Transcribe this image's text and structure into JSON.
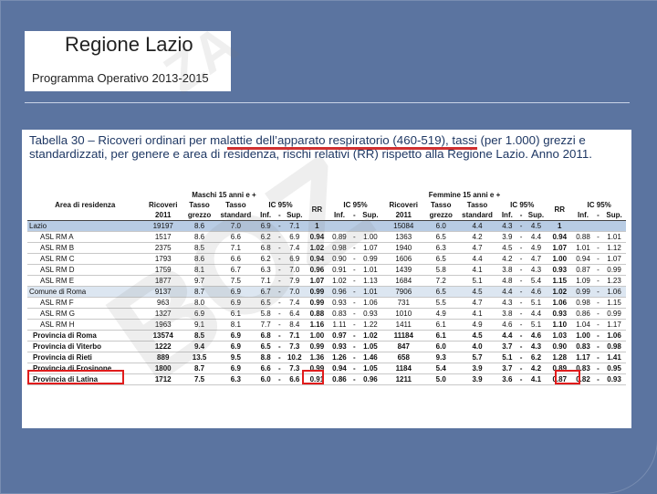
{
  "header": {
    "title": "Regione Lazio",
    "subtitle": "Programma Operativo 2013-2015"
  },
  "caption": "Tabella 30 – Ricoveri ordinari per malattie dell’apparato respiratorio (460-519), tassi (per 1.000) grezzi e standardizzati, per genere e area di residenza, rischi relativi (RR) rispetto alla Regione Lazio. Anno 2011.",
  "watermark": {
    "main": "BOZ",
    "top": "ZA"
  },
  "table": {
    "group_males": "Maschi  15 anni e +",
    "group_females": "Femmine  15 anni e +",
    "ic_label": "IC 95%",
    "h1": [
      "Area di residenza",
      "Ricoveri",
      "Tasso",
      "Tasso",
      "IC 95%",
      "RR",
      "IC 95%",
      "Ricoveri",
      "Tasso",
      "Tasso",
      "IC 95%",
      "RR",
      "IC 95%"
    ],
    "h2": [
      "",
      "2011",
      "grezzo",
      "standard",
      "Inf.",
      "-",
      "Sup.",
      "",
      "Inf.",
      "-",
      "Sup.",
      "2011",
      "grezzo",
      "standard",
      "Inf.",
      "-",
      "Sup.",
      "",
      "Inf.",
      "-",
      "Sup."
    ],
    "rows": [
      [
        "Lazio",
        "19197",
        "8.6",
        "7.0",
        "6.9",
        "-",
        "7.1",
        "1",
        "",
        "",
        "",
        "15084",
        "6.0",
        "4.4",
        "4.3",
        "-",
        "4.5",
        "1",
        "",
        "",
        ""
      ],
      [
        "ASL RM A",
        "1517",
        "8.6",
        "6.6",
        "6.2",
        "-",
        "6.9",
        "0.94",
        "0.89",
        "-",
        "1.00",
        "1363",
        "6.5",
        "4.2",
        "3.9",
        "-",
        "4.4",
        "0.94",
        "0.88",
        "-",
        "1.01"
      ],
      [
        "ASL RM B",
        "2375",
        "8.5",
        "7.1",
        "6.8",
        "-",
        "7.4",
        "1.02",
        "0.98",
        "-",
        "1.07",
        "1940",
        "6.3",
        "4.7",
        "4.5",
        "-",
        "4.9",
        "1.07",
        "1.01",
        "-",
        "1.12"
      ],
      [
        "ASL RM C",
        "1793",
        "8.6",
        "6.6",
        "6.2",
        "-",
        "6.9",
        "0.94",
        "0.90",
        "-",
        "0.99",
        "1606",
        "6.5",
        "4.4",
        "4.2",
        "-",
        "4.7",
        "1.00",
        "0.94",
        "-",
        "1.07"
      ],
      [
        "ASL RM D",
        "1759",
        "8.1",
        "6.7",
        "6.3",
        "-",
        "7.0",
        "0.96",
        "0.91",
        "-",
        "1.01",
        "1439",
        "5.8",
        "4.1",
        "3.8",
        "-",
        "4.3",
        "0.93",
        "0.87",
        "-",
        "0.99"
      ],
      [
        "ASL RM E",
        "1877",
        "9.7",
        "7.5",
        "7.1",
        "-",
        "7.9",
        "1.07",
        "1.02",
        "-",
        "1.13",
        "1684",
        "7.2",
        "5.1",
        "4.8",
        "-",
        "5.4",
        "1.15",
        "1.09",
        "-",
        "1.23"
      ],
      [
        "Comune di Roma",
        "9137",
        "8.7",
        "6.9",
        "6.7",
        "-",
        "7.0",
        "0.99",
        "0.96",
        "-",
        "1.01",
        "7906",
        "6.5",
        "4.5",
        "4.4",
        "-",
        "4.6",
        "1.02",
        "0.99",
        "-",
        "1.06"
      ],
      [
        "ASL RM F",
        "963",
        "8.0",
        "6.9",
        "6.5",
        "-",
        "7.4",
        "0.99",
        "0.93",
        "-",
        "1.06",
        "731",
        "5.5",
        "4.7",
        "4.3",
        "-",
        "5.1",
        "1.06",
        "0.98",
        "-",
        "1.15"
      ],
      [
        "ASL RM G",
        "1327",
        "6.9",
        "6.1",
        "5.8",
        "-",
        "6.4",
        "0.88",
        "0.83",
        "-",
        "0.93",
        "1010",
        "4.9",
        "4.1",
        "3.8",
        "-",
        "4.4",
        "0.93",
        "0.86",
        "-",
        "0.99"
      ],
      [
        "ASL RM H",
        "1963",
        "9.1",
        "8.1",
        "7.7",
        "-",
        "8.4",
        "1.16",
        "1.11",
        "-",
        "1.22",
        "1411",
        "6.1",
        "4.9",
        "4.6",
        "-",
        "5.1",
        "1.10",
        "1.04",
        "-",
        "1.17"
      ],
      [
        "Provincia di Roma",
        "13574",
        "8.5",
        "6.9",
        "6.8",
        "-",
        "7.1",
        "1.00",
        "0.97",
        "-",
        "1.02",
        "11184",
        "6.1",
        "4.5",
        "4.4",
        "-",
        "4.6",
        "1.03",
        "1.00",
        "-",
        "1.06"
      ],
      [
        "Provincia di Viterbo",
        "1222",
        "9.4",
        "6.9",
        "6.5",
        "-",
        "7.3",
        "0.99",
        "0.93",
        "-",
        "1.05",
        "847",
        "6.0",
        "4.0",
        "3.7",
        "-",
        "4.3",
        "0.90",
        "0.83",
        "-",
        "0.98"
      ],
      [
        "Provincia di Rieti",
        "889",
        "13.5",
        "9.5",
        "8.8",
        "-",
        "10.2",
        "1.36",
        "1.26",
        "-",
        "1.46",
        "658",
        "9.3",
        "5.7",
        "5.1",
        "-",
        "6.2",
        "1.28",
        "1.17",
        "-",
        "1.41"
      ],
      [
        "Provincia di Frosinone",
        "1800",
        "8.7",
        "6.9",
        "6.6",
        "-",
        "7.3",
        "0.99",
        "0.94",
        "-",
        "1.05",
        "1184",
        "5.4",
        "3.9",
        "3.7",
        "-",
        "4.2",
        "0.89",
        "0.83",
        "-",
        "0.95"
      ],
      [
        "Provincia di Latina",
        "1712",
        "7.5",
        "6.3",
        "6.0",
        "-",
        "6.6",
        "0.91",
        "0.86",
        "-",
        "0.96",
        "1211",
        "5.0",
        "3.9",
        "3.6",
        "-",
        "4.1",
        "0.87",
        "0.82",
        "-",
        "0.93"
      ]
    ],
    "row_types": [
      "lazio",
      "",
      "",
      "",
      "",
      "",
      "roma",
      "",
      "",
      "",
      "prov",
      "prov",
      "prov",
      "prov",
      "prov"
    ]
  },
  "colors": {
    "background": "#5b74a0",
    "highlight": "#e01c1c",
    "underline": "#d03030",
    "lazio_row": "#b8cce4",
    "roma_row": "#dce6f1"
  }
}
